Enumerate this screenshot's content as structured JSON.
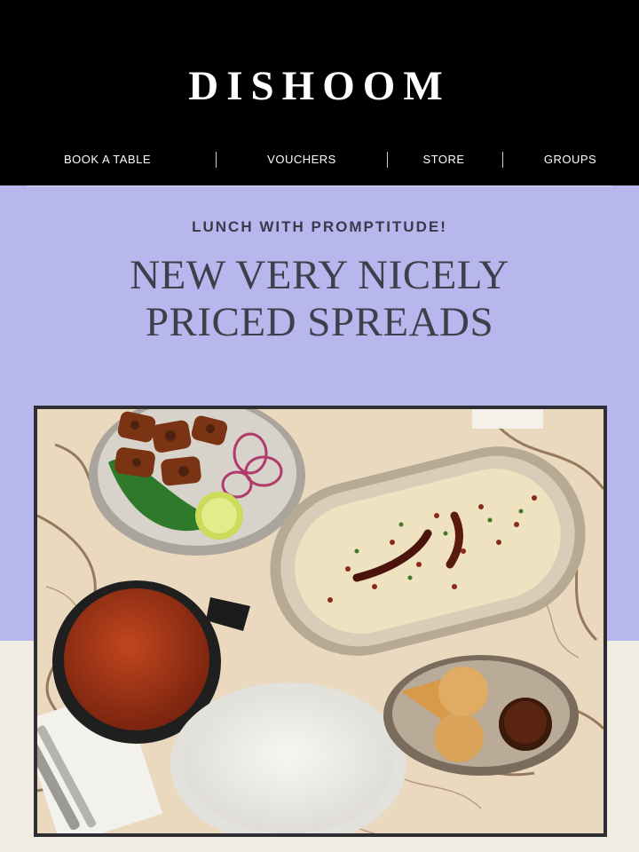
{
  "brand": {
    "logo_text": "DISHOOM"
  },
  "nav": {
    "items": [
      {
        "label": "BOOK A TABLE"
      },
      {
        "label": "VOUCHERS"
      },
      {
        "label": "STORE"
      },
      {
        "label": "GROUPS"
      }
    ]
  },
  "hero": {
    "kicker": "LUNCH WITH PROMPTITUDE!",
    "headline_line1": "NEW VERY NICELY",
    "headline_line2": "PRICED SPREADS"
  },
  "colors": {
    "header_bg": "#000000",
    "hero_bg": "#b7b7ee",
    "page_bg": "#f1ede2",
    "headline_text": "#3f3f4b"
  }
}
